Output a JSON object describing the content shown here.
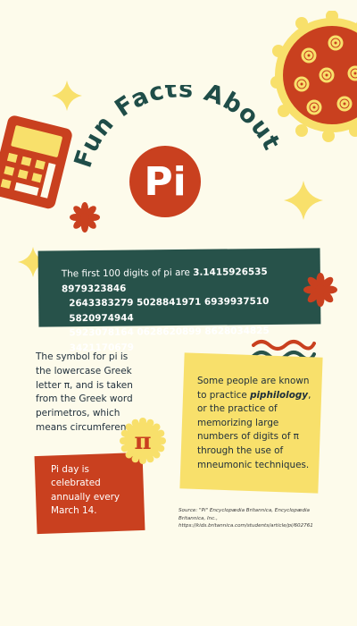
{
  "title": {
    "line": "Fun Facts About",
    "pi_word": "Pi"
  },
  "digits": {
    "lead": "The first 100 digits of pi are",
    "line1": "3.1415926535 8979323846",
    "line2": "2643383279 5028841971 6939937510 5820974944",
    "line3": "5923078164 0628620899 8628034825 3421170679"
  },
  "symbol_fact": "The symbol for pi is the lowercase Greek letter π, and is taken from the Greek word perimetros, which means circumference.",
  "piphilology": {
    "before": "Some people are known to practice ",
    "term": "piphilology",
    "after": ", or the practice of memorizing large numbers of digits of π through the use of mneumonic techniques."
  },
  "pi_day": "Pi day is celebrated annually every March 14.",
  "badge_symbol": "π",
  "source": "Source: \"Pi\" Encyclopædia Britannica, Encyclopædia Britannica, Inc., https://kids.britannica.com/students/article/pi/602761",
  "colors": {
    "background": "#fdfbeb",
    "teal": "#27524a",
    "red": "#c9401f",
    "yellow": "#f8e06b",
    "dark_text": "#1e2e3a"
  }
}
